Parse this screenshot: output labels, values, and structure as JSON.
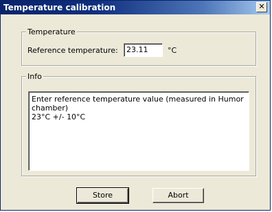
{
  "window": {
    "title": "Temperature calibration",
    "close_glyph": "✕"
  },
  "temperature_group": {
    "legend": "Temperature",
    "reference_label": "Reference temperature:",
    "reference_value": "23.11",
    "unit": "°C"
  },
  "info_group": {
    "legend": "Info",
    "text": "Enter reference temperature value (measured in Humor chamber)\n23°C +/- 10°C"
  },
  "buttons": {
    "store": "Store",
    "abort": "Abort"
  }
}
